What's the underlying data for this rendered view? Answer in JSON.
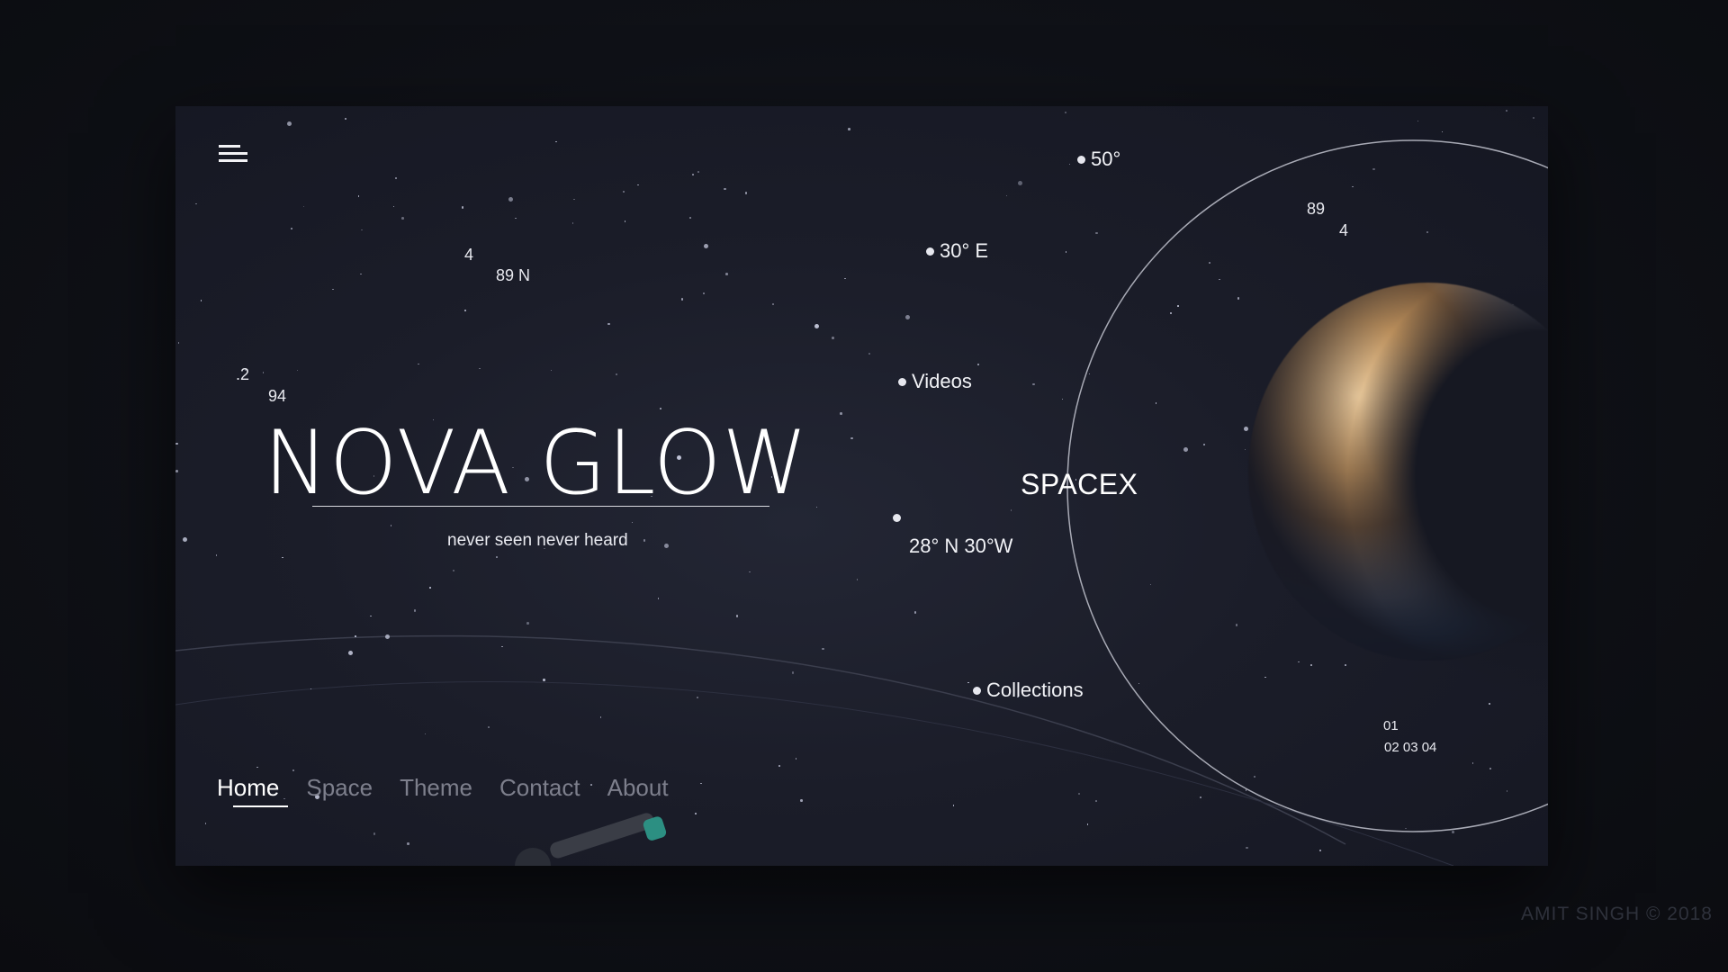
{
  "header": {
    "menu_icon": "hamburger-menu-icon"
  },
  "coordinates_left": {
    "a": "4",
    "b": "89 N",
    "c": ".2",
    "d": "94"
  },
  "coordinates_right": {
    "a": "89",
    "b": "4"
  },
  "hotspots": {
    "degrees": "50°",
    "east": "30° E",
    "videos": "Videos",
    "position": "28° N 30°W",
    "collections": "Collections"
  },
  "hero": {
    "title": "NOVA GLOW",
    "subtitle": "never seen never heard"
  },
  "brand_label": "SPACEX",
  "pager": {
    "current": "01",
    "rest": "02 03 04"
  },
  "nav": {
    "items": [
      {
        "label": "Home",
        "active": true
      },
      {
        "label": "Space",
        "active": false
      },
      {
        "label": "Theme",
        "active": false
      },
      {
        "label": "Contact",
        "active": false
      },
      {
        "label": "About",
        "active": false
      }
    ]
  },
  "footer": {
    "copyright": "AMIT SINGH © 2018"
  },
  "colors": {
    "background": "#1b1d29",
    "accent": "#ffffff",
    "muted_nav": "#7d7f8c"
  }
}
